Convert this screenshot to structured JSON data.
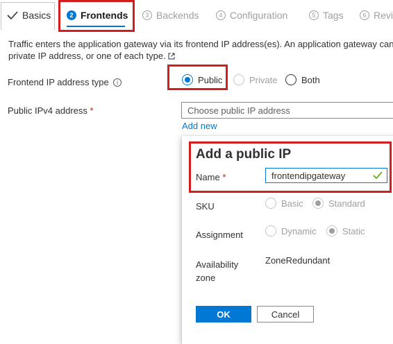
{
  "tabs": [
    {
      "label": "Basics",
      "state": "completed"
    },
    {
      "step": "2",
      "label": "Frontends",
      "state": "active"
    },
    {
      "step": "3",
      "label": "Backends",
      "state": "disabled"
    },
    {
      "step": "4",
      "label": "Configuration",
      "state": "disabled"
    },
    {
      "step": "5",
      "label": "Tags",
      "state": "disabled"
    },
    {
      "step": "6",
      "label": "Revi",
      "state": "disabled"
    }
  ],
  "description": {
    "line1": "Traffic enters the application gateway via its frontend IP address(es). An application gateway can c",
    "line2": "private IP address, or one of each type."
  },
  "frontend_ip_type": {
    "label": "Frontend IP address type",
    "options": [
      {
        "label": "Public",
        "selected": true
      },
      {
        "label": "Private",
        "selected": false,
        "disabled": true
      },
      {
        "label": "Both",
        "selected": false
      }
    ]
  },
  "public_ipv4": {
    "label": "Public IPv4 address",
    "required_mark": "*",
    "placeholder": "Choose public IP address",
    "add_new_link": "Add new"
  },
  "add_public_ip_panel": {
    "title": "Add a public IP",
    "name_label": "Name",
    "name_required_mark": "*",
    "name_value": "frontendipgateway",
    "sku_label": "SKU",
    "sku_options": [
      {
        "label": "Basic",
        "selected": false
      },
      {
        "label": "Standard",
        "selected": true
      }
    ],
    "assignment_label": "Assignment",
    "assignment_options": [
      {
        "label": "Dynamic",
        "selected": false
      },
      {
        "label": "Static",
        "selected": true
      }
    ],
    "availability_zone_label_1": "Availability",
    "availability_zone_label_2": "zone",
    "availability_zone_value": "ZoneRedundant",
    "ok_button": "OK",
    "cancel_button": "Cancel"
  },
  "colors": {
    "accent": "#0078d4",
    "highlight_box": "#d41c1c",
    "required": "#a4262c",
    "valid_check": "#57a300"
  },
  "icons": {
    "basics": "checkmark-icon",
    "description": "external-link-icon",
    "frontend_ip_type": "info-icon",
    "name_field": "checkmark-icon"
  }
}
